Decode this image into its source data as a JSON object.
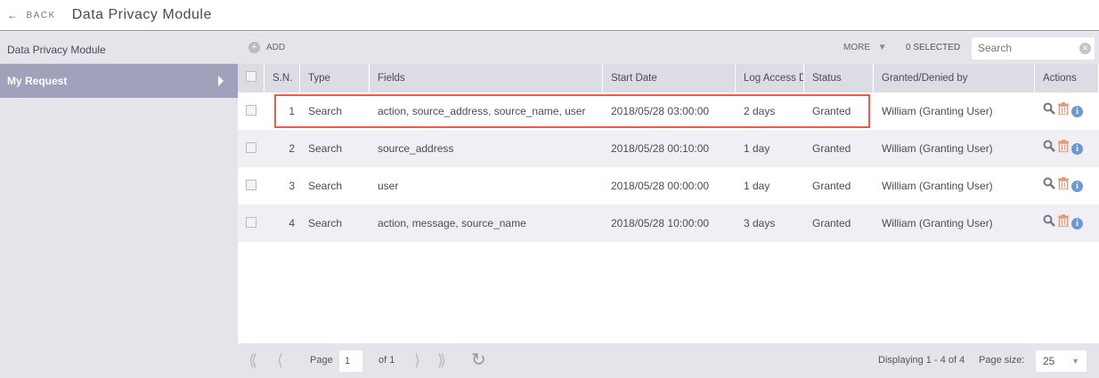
{
  "header": {
    "back_label": "BACK",
    "title": "Data Privacy Module"
  },
  "sidebar": {
    "heading": "Data Privacy Module",
    "items": [
      {
        "label": "My Request"
      }
    ]
  },
  "toolbar": {
    "add_label": "ADD",
    "more_label": "MORE",
    "selected_label": "0 SELECTED",
    "search_placeholder": "Search"
  },
  "table": {
    "columns": [
      "S.N.",
      "Type",
      "Fields",
      "Start Date",
      "Log Access D",
      "Status",
      "Granted/Denied by",
      "Actions"
    ],
    "rows": [
      {
        "sn": "1",
        "type": "Search",
        "fields": "action, source_address, source_name, user",
        "start": "2018/05/28 03:00:00",
        "log": "2 days",
        "status": "Granted",
        "by": "William (Granting User)"
      },
      {
        "sn": "2",
        "type": "Search",
        "fields": "source_address",
        "start": "2018/05/28 00:10:00",
        "log": "1 day",
        "status": "Granted",
        "by": "William (Granting User)"
      },
      {
        "sn": "3",
        "type": "Search",
        "fields": "user",
        "start": "2018/05/28 00:00:00",
        "log": "1 day",
        "status": "Granted",
        "by": "William (Granting User)"
      },
      {
        "sn": "4",
        "type": "Search",
        "fields": "action, message, source_name",
        "start": "2018/05/28 10:00:00",
        "log": "3 days",
        "status": "Granted",
        "by": "William (Granting User)"
      }
    ]
  },
  "pager": {
    "page_label": "Page",
    "page": "1",
    "of_label": "of 1",
    "displaying": "Displaying 1 - 4 of 4",
    "page_size_label": "Page size:",
    "page_size": "25"
  },
  "colors": {
    "highlight": "#f05a4a",
    "sidebar_active": "#a0a2bc"
  }
}
